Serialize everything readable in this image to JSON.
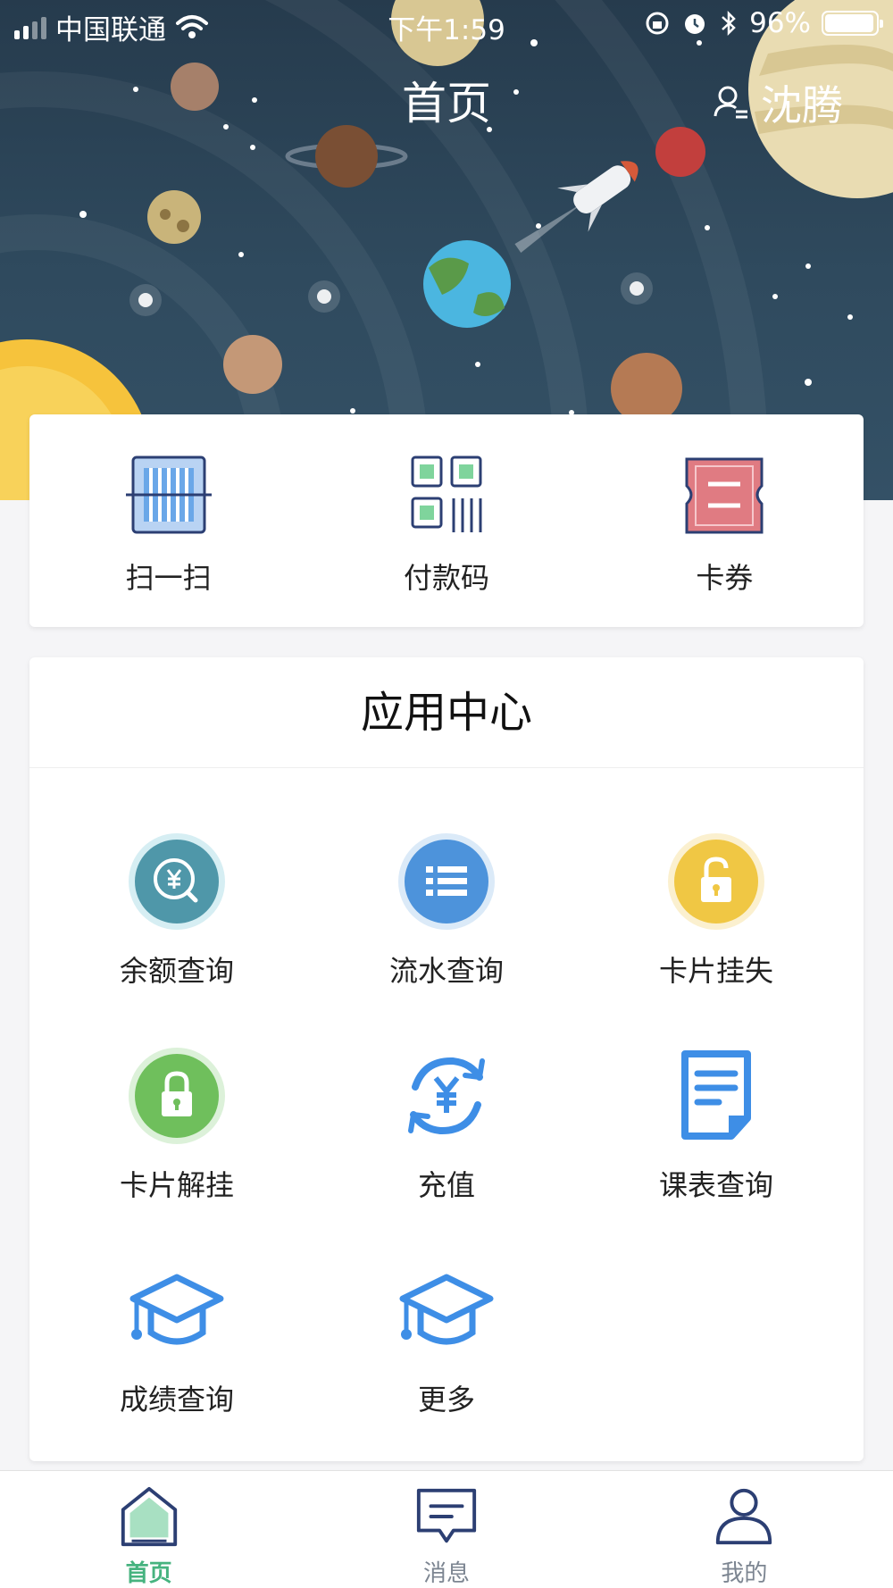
{
  "status_bar": {
    "carrier": "中国联通",
    "time": "下午1:59",
    "battery": "96%",
    "battery_level": 0.96
  },
  "header": {
    "title": "首页",
    "username": "沈腾"
  },
  "quick_actions": [
    {
      "label": "扫一扫",
      "icon": "scan-icon"
    },
    {
      "label": "付款码",
      "icon": "payment-code-icon"
    },
    {
      "label": "卡券",
      "icon": "coupon-icon"
    }
  ],
  "app_center": {
    "title": "应用中心",
    "items": [
      {
        "label": "余额查询",
        "icon": "balance-icon"
      },
      {
        "label": "流水查询",
        "icon": "transactions-icon"
      },
      {
        "label": "卡片挂失",
        "icon": "lock-icon"
      },
      {
        "label": "卡片解挂",
        "icon": "unlock-icon"
      },
      {
        "label": "充值",
        "icon": "recharge-icon"
      },
      {
        "label": "课表查询",
        "icon": "document-icon"
      },
      {
        "label": "成绩查询",
        "icon": "graduation-cap-icon"
      },
      {
        "label": "更多",
        "icon": "graduation-cap-icon"
      }
    ]
  },
  "tab_bar": [
    {
      "label": "首页",
      "icon": "home-icon",
      "active": true
    },
    {
      "label": "消息",
      "icon": "message-icon",
      "active": false
    },
    {
      "label": "我的",
      "icon": "profile-icon",
      "active": false
    }
  ],
  "colors": {
    "accent": "#46b37f",
    "icon_blue": "#3e8ee6",
    "hero_bg": "#263b4d"
  }
}
